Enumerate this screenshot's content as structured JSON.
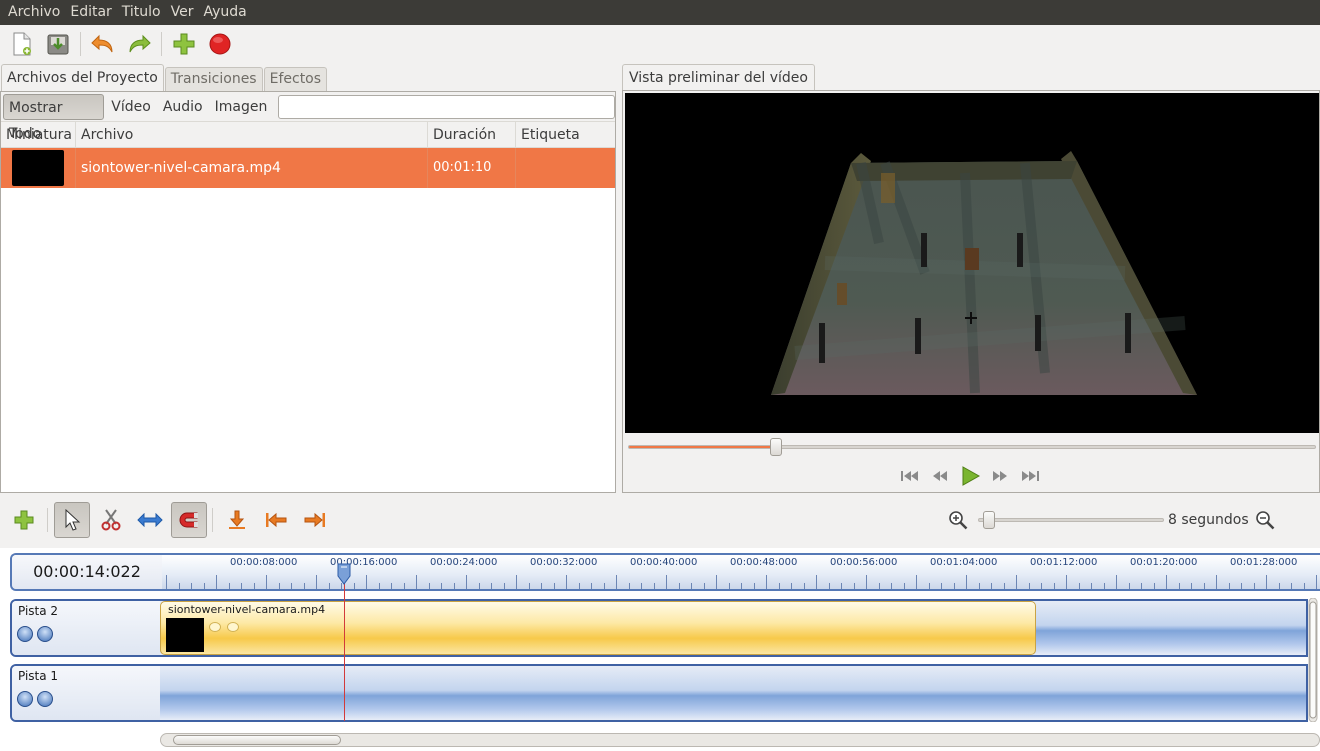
{
  "menu": [
    "Archivo",
    "Editar",
    "Titulo",
    "Ver",
    "Ayuda"
  ],
  "toolbar": {
    "icons": [
      "new-project-icon",
      "save-project-icon",
      "undo-icon",
      "redo-icon",
      "add-files-icon",
      "record-icon"
    ]
  },
  "left_tabs": [
    "Archivos del Proyecto",
    "Transiciones",
    "Efectos"
  ],
  "filters": [
    "Mostrar Todo",
    "Vídeo",
    "Audio",
    "Imagen"
  ],
  "search": {
    "value": ""
  },
  "file_columns": [
    "Miniatura",
    "Archivo",
    "Duración",
    "Etiqueta"
  ],
  "files": [
    {
      "file": "siontower-nivel-camara.mp4",
      "duration": "00:01:10",
      "label": ""
    }
  ],
  "preview": {
    "tab": "Vista preliminar del vídeo",
    "progress_percent": 21.5
  },
  "timeline": {
    "zoom_label": "8 segundos",
    "zoom_fraction": 0.02,
    "timecode": "00:00:14:022",
    "ruler_labels": [
      "00:00:08:000",
      "00:00:16:000",
      "00:00:24:000",
      "00:00:32:000",
      "00:00:40:000",
      "00:00:48:000",
      "00:00:56:000",
      "00:01:04:000",
      "00:01:12:000",
      "00:01:20:000",
      "00:01:28:000"
    ],
    "tracks": [
      {
        "name": "Pista 2",
        "clip": "siontower-nivel-camara.mp4"
      },
      {
        "name": "Pista 1"
      }
    ]
  },
  "colors": {
    "accent": "#f07746",
    "menubar": "#3c3b37",
    "clip": "#f7c94a",
    "track": "#7fa4d9",
    "playhead": "#d23a3a"
  }
}
